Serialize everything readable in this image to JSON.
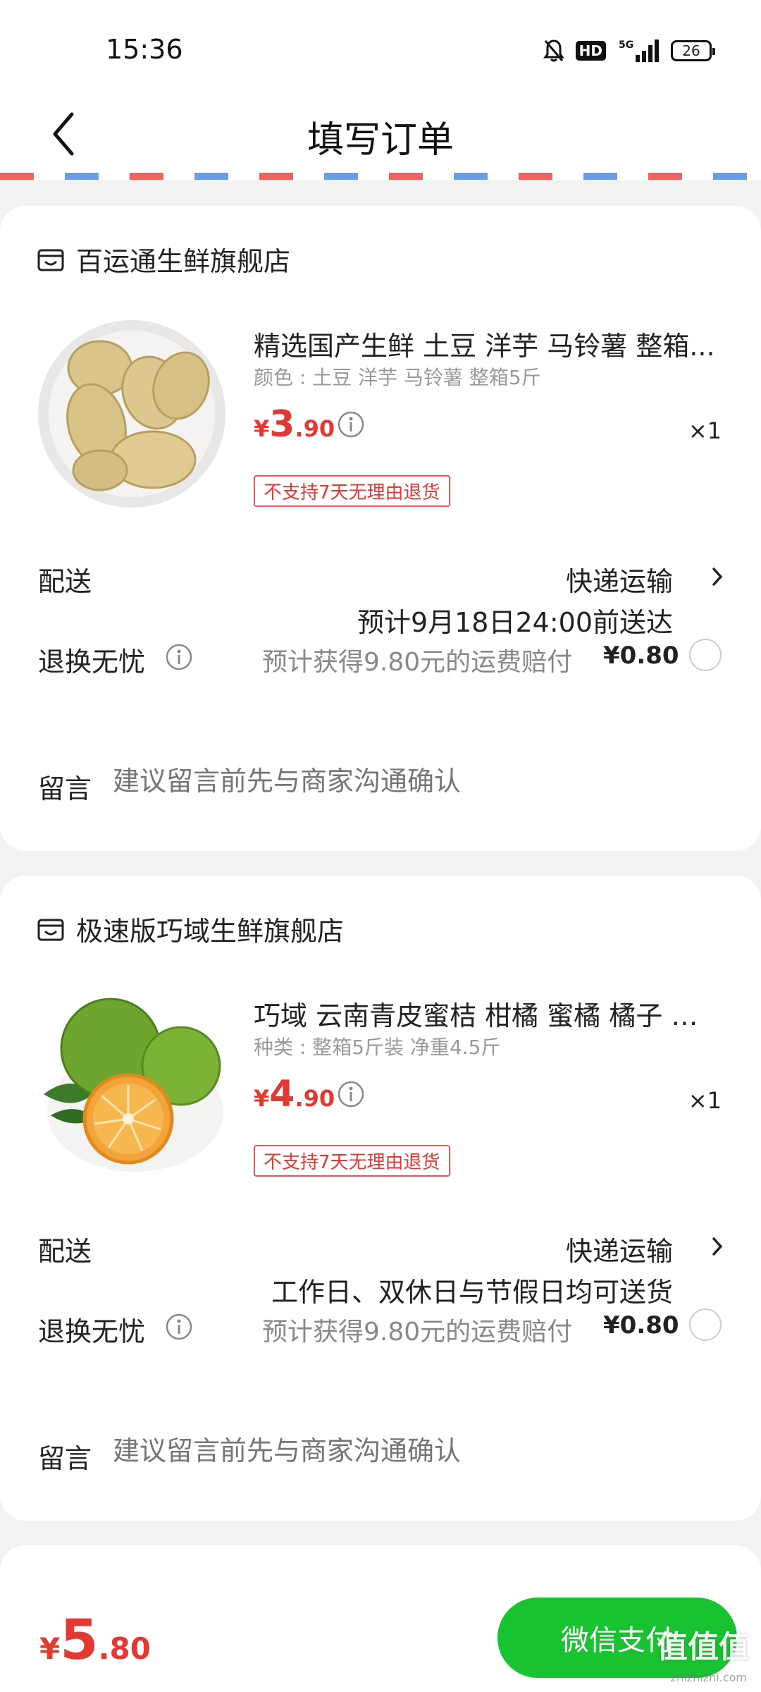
{
  "status_bar": {
    "time": "15:36",
    "network": "5G",
    "hd": "HD",
    "battery": "26"
  },
  "nav": {
    "title": "填写订单"
  },
  "stores": [
    {
      "name": "百运通生鲜旗舰店",
      "product": {
        "title": "精选国产生鲜 土豆 洋芋 马铃薯 整箱...",
        "spec": "颜色 : 土豆 洋芋 马铃薯 整箱5斤",
        "price_currency": "¥",
        "price_int": "3",
        "price_dec": ".90",
        "qty": "×1",
        "tag": "不支持7天无理由退货"
      },
      "shipping": {
        "label": "配送",
        "method": "快递运输",
        "note": "预计9月18日24:00前送达"
      },
      "returns": {
        "label": "退换无忧",
        "desc": "预计获得9.80元的运费赔付",
        "price": "¥0.80"
      },
      "message": {
        "label": "留言",
        "placeholder": "建议留言前先与商家沟通确认"
      }
    },
    {
      "name": "极速版巧域生鲜旗舰店",
      "product": {
        "title": "巧域 云南青皮蜜桔 柑橘 蜜橘 橘子 桔...",
        "spec": "种类 : 整箱5斤装 净重4.5斤",
        "price_currency": "¥",
        "price_int": "4",
        "price_dec": ".90",
        "qty": "×1",
        "tag": "不支持7天无理由退货"
      },
      "shipping": {
        "label": "配送",
        "method": "快递运输",
        "note": "工作日、双休日与节假日均可送货"
      },
      "returns": {
        "label": "退换无忧",
        "desc": "预计获得9.80元的运费赔付",
        "price": "¥0.80"
      },
      "message": {
        "label": "留言",
        "placeholder": "建议留言前先与商家沟通确认"
      }
    }
  ],
  "bottom": {
    "total_currency": "¥",
    "total_int": "5",
    "total_dec": ".80",
    "pay_label": "微信支付"
  },
  "watermark": {
    "main": "值值值",
    "sub": "zhizhizhi.com"
  },
  "colors": {
    "price_red": "#e23a33",
    "pay_green": "#19c230",
    "airmail_red": "#f06262",
    "airmail_blue": "#6b9ce8"
  }
}
